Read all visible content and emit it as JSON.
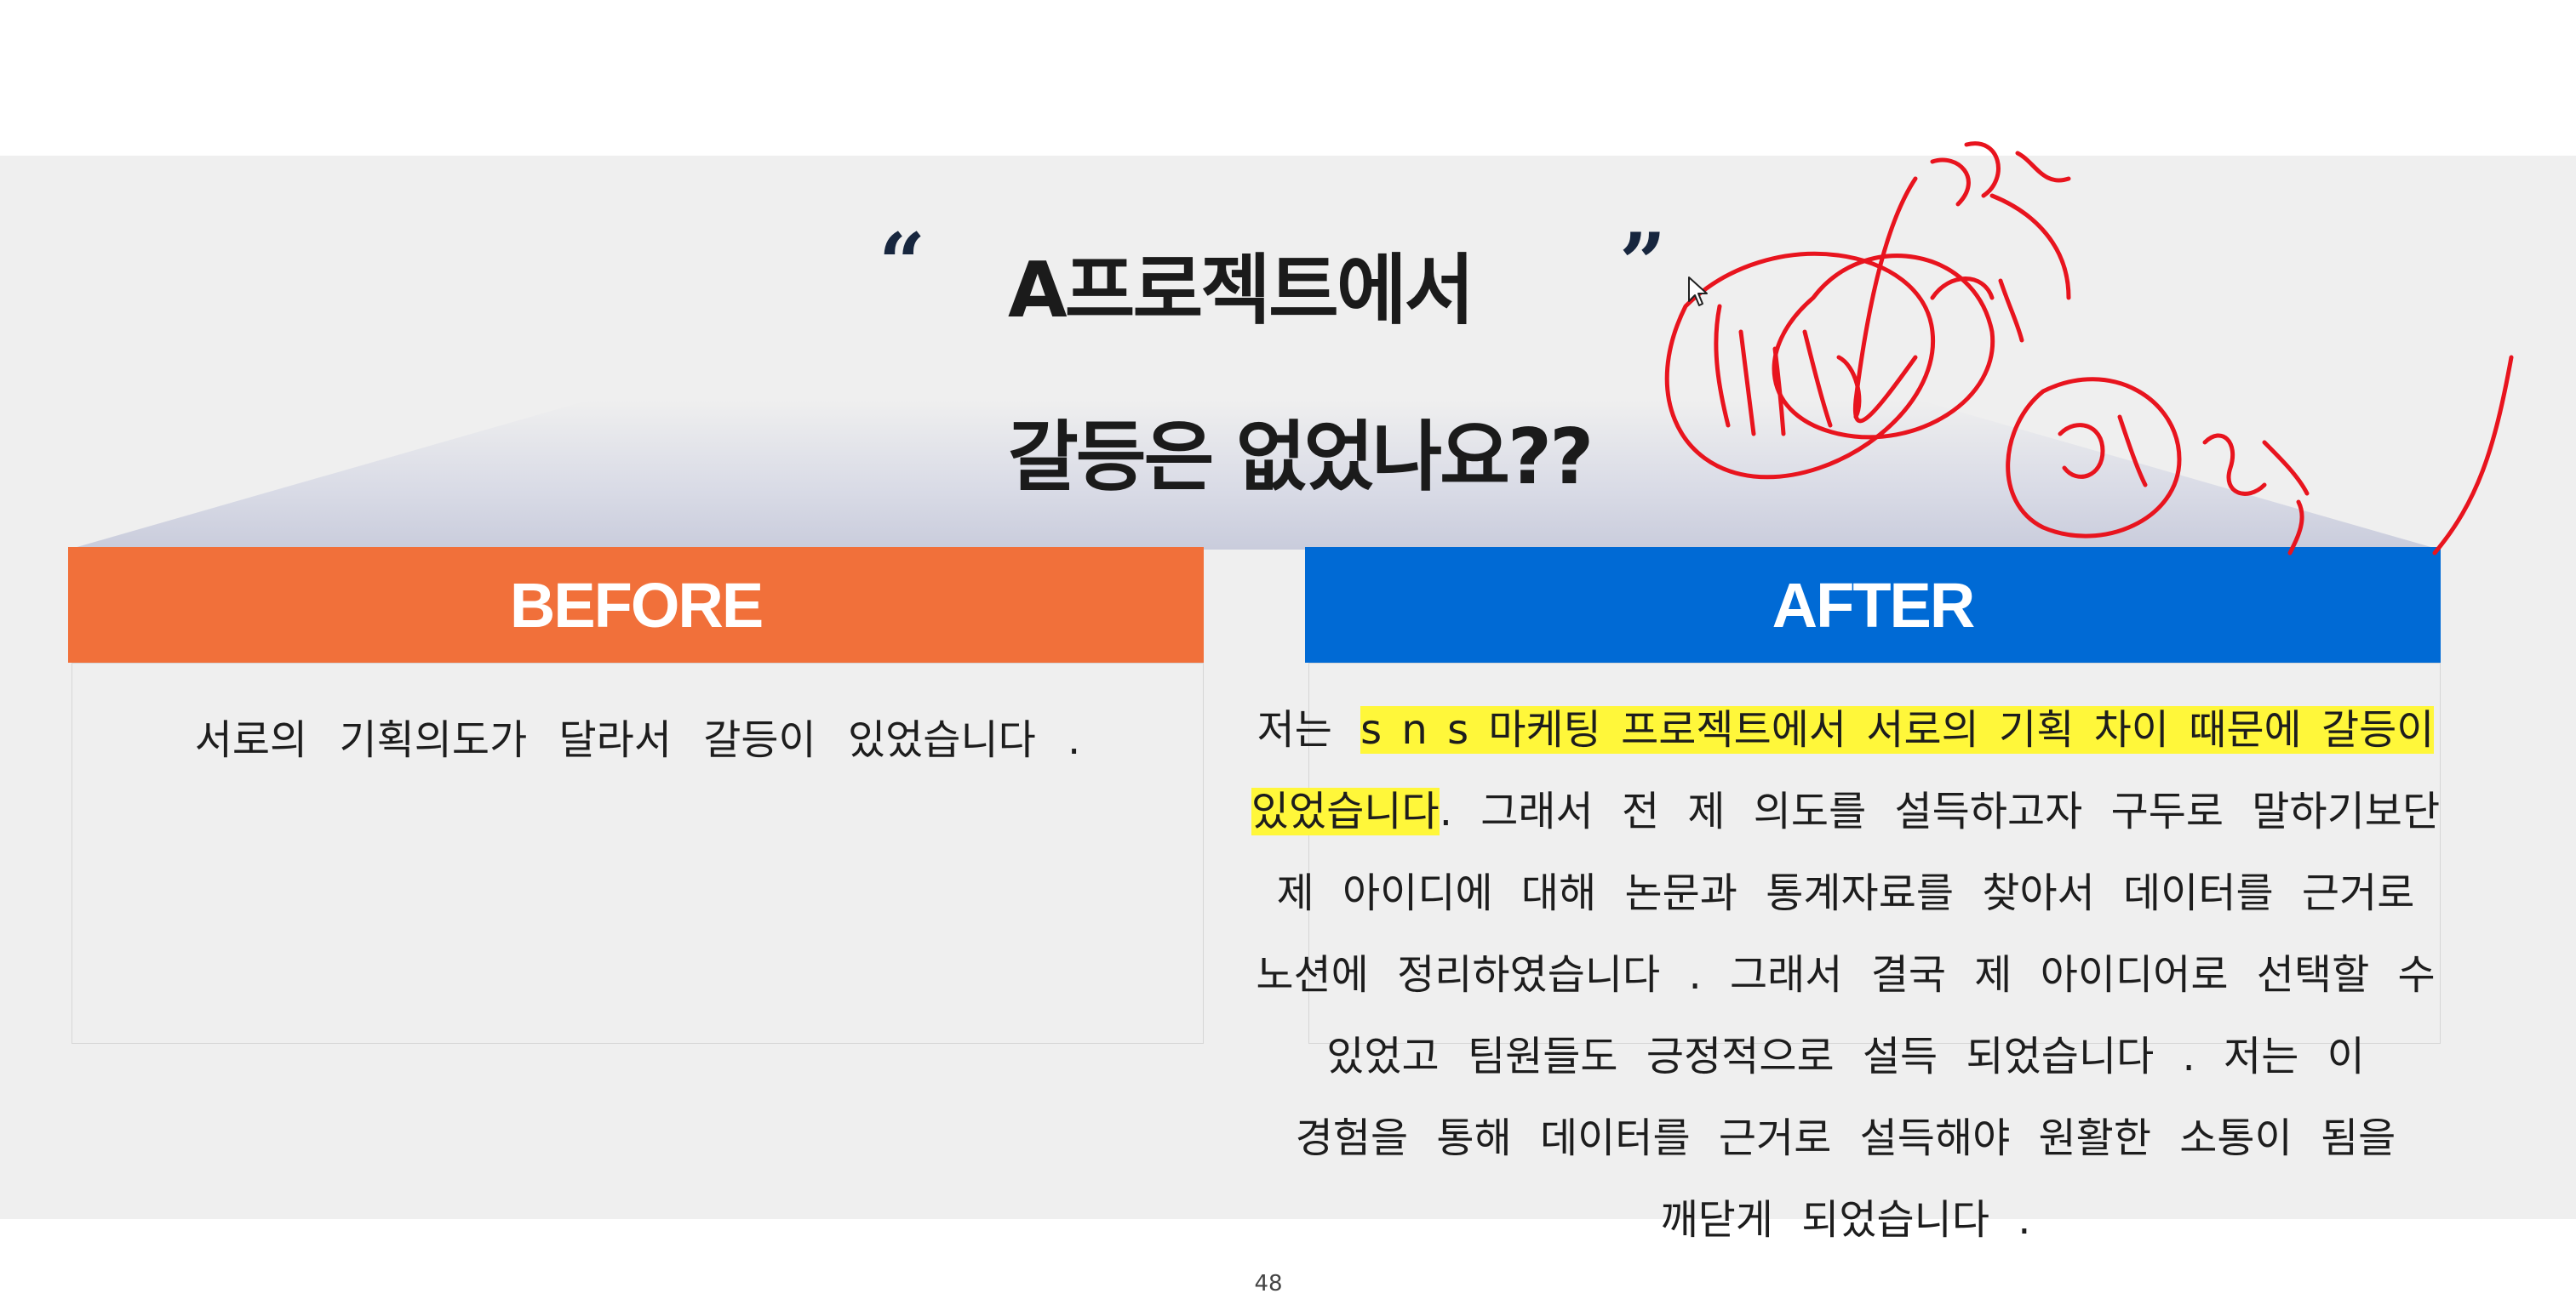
{
  "title": {
    "quote_open": "“",
    "line1": "A프로젝트에서",
    "line2": "갈등은 없었나요??",
    "quote_close": "”"
  },
  "before": {
    "header": "BEFORE",
    "text": "서로의 기획의도가 달라서 갈등이 있었습니다 ."
  },
  "after": {
    "header": "AFTER",
    "line1_prefix": "저는 ",
    "line1_highlight": "s n s 마케팅 프로젝트에서 서로의 기획 차이 때문에 갈등이",
    "line2_highlight": "있었습니다",
    "line2_rest": ". 그래서 전 제 의도를 설득하고자 구두로 말하기보단",
    "line3": "제 아이디에 대해 논문과 통계자료를 찾아서 데이터를 근거로",
    "line4": "노션에 정리하였습니다 . 그래서 결국 제 아이디어로 선택할 수",
    "line5": "있었고 팀원들도 긍정적으로 설득 되었습니다 . 저는 이",
    "line6": "경험을 통해 데이터를 근거로 설득해야 원활한 소통이 됨을",
    "line7": "깨닫게 되었습니다 ."
  },
  "page_number": "48",
  "colors": {
    "before_header": "#f1703a",
    "after_header": "#006ad5",
    "highlight": "#fff73a",
    "annotation_ink": "#e8141e",
    "band": "#efefef"
  },
  "icons": {
    "cursor": "mouse-pointer-icon",
    "annotation": "handwritten-ink-annotation"
  }
}
